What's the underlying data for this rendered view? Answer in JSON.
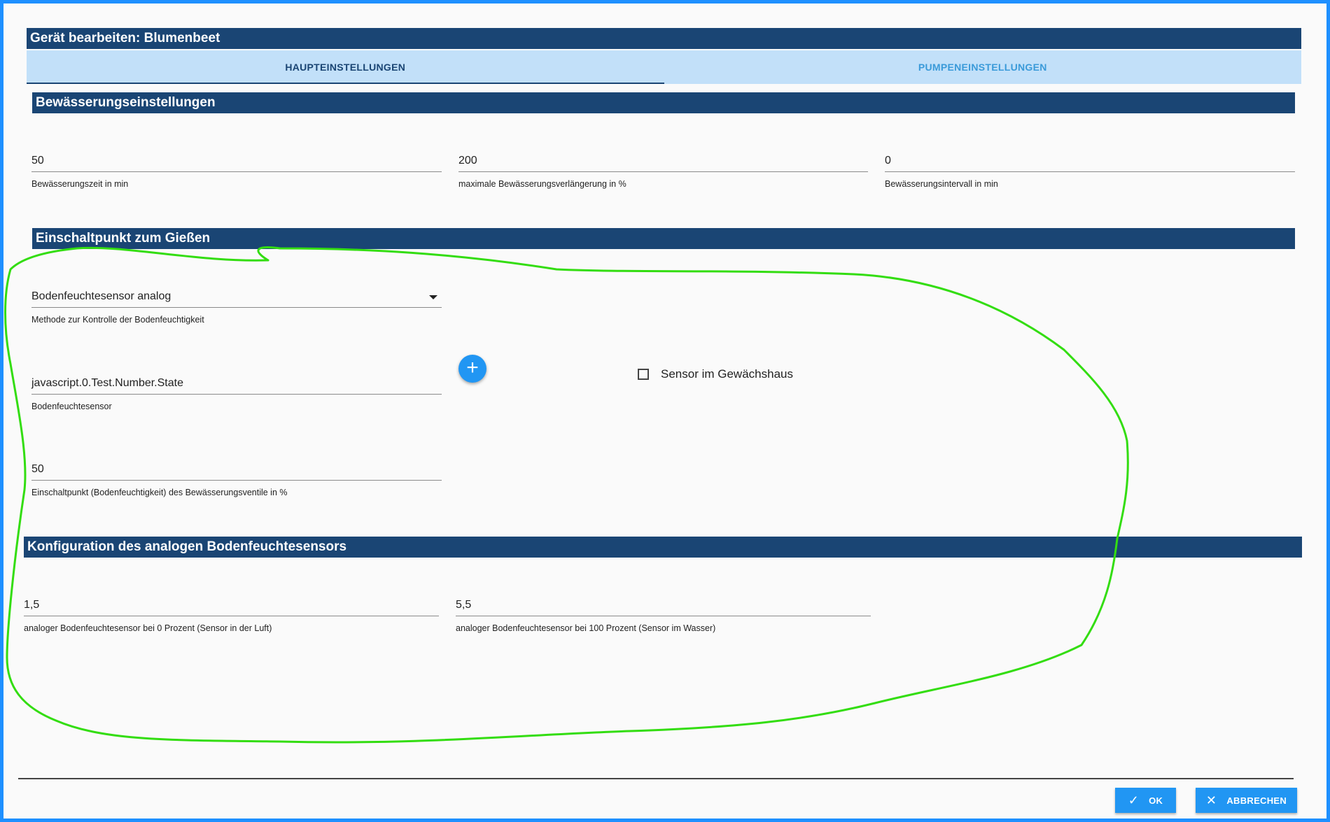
{
  "dialog": {
    "title": "Gerät bearbeiten: Blumenbeet"
  },
  "tabs": [
    {
      "label": "HAUPTEINSTELLUNGEN",
      "active": true
    },
    {
      "label": "PUMPENEINSTELLUNGEN",
      "active": false
    }
  ],
  "irrigation": {
    "header": "Bewässerungseinstellungen",
    "fields": [
      {
        "value": "50",
        "label": "Bewässerungszeit in min"
      },
      {
        "value": "200",
        "label": "maximale Bewässerungsverlängerung in %"
      },
      {
        "value": "0",
        "label": "Bewässerungsintervall in min"
      }
    ]
  },
  "trigger": {
    "header": "Einschaltpunkt zum Gießen",
    "method": {
      "value": "Bodenfeuchtesensor analog",
      "label": "Methode zur Kontrolle der Bodenfeuchtigkeit"
    },
    "sensor": {
      "value": "javascript.0.Test.Number.State",
      "label": "Bodenfeuchtesensor"
    },
    "threshold": {
      "value": "50",
      "label": "Einschaltpunkt (Bodenfeuchtigkeit) des Bewässerungsventile in %"
    },
    "add_button": "+",
    "greenhouse": {
      "label": "Sensor im Gewächshaus",
      "checked": false
    }
  },
  "analog_config": {
    "header": "Konfiguration des analogen Bodenfeuchtesensors",
    "fields": [
      {
        "value": "1,5",
        "label": "analoger Bodenfeuchtesensor bei 0 Prozent (Sensor in der Luft)"
      },
      {
        "value": "5,5",
        "label": "analoger Bodenfeuchtesensor bei 100 Prozent (Sensor im Wasser)"
      }
    ]
  },
  "footer": {
    "ok_label": "OK",
    "cancel_label": "ABBRECHEN"
  },
  "colors": {
    "header_bg": "#1a4574",
    "tab_bg": "#c2e0f9",
    "accent": "#2196f3",
    "annotation": "#33dd11"
  },
  "icons": {
    "ok": "check-icon",
    "cancel": "close-icon",
    "add": "plus-icon",
    "select": "chevron-down-icon"
  }
}
